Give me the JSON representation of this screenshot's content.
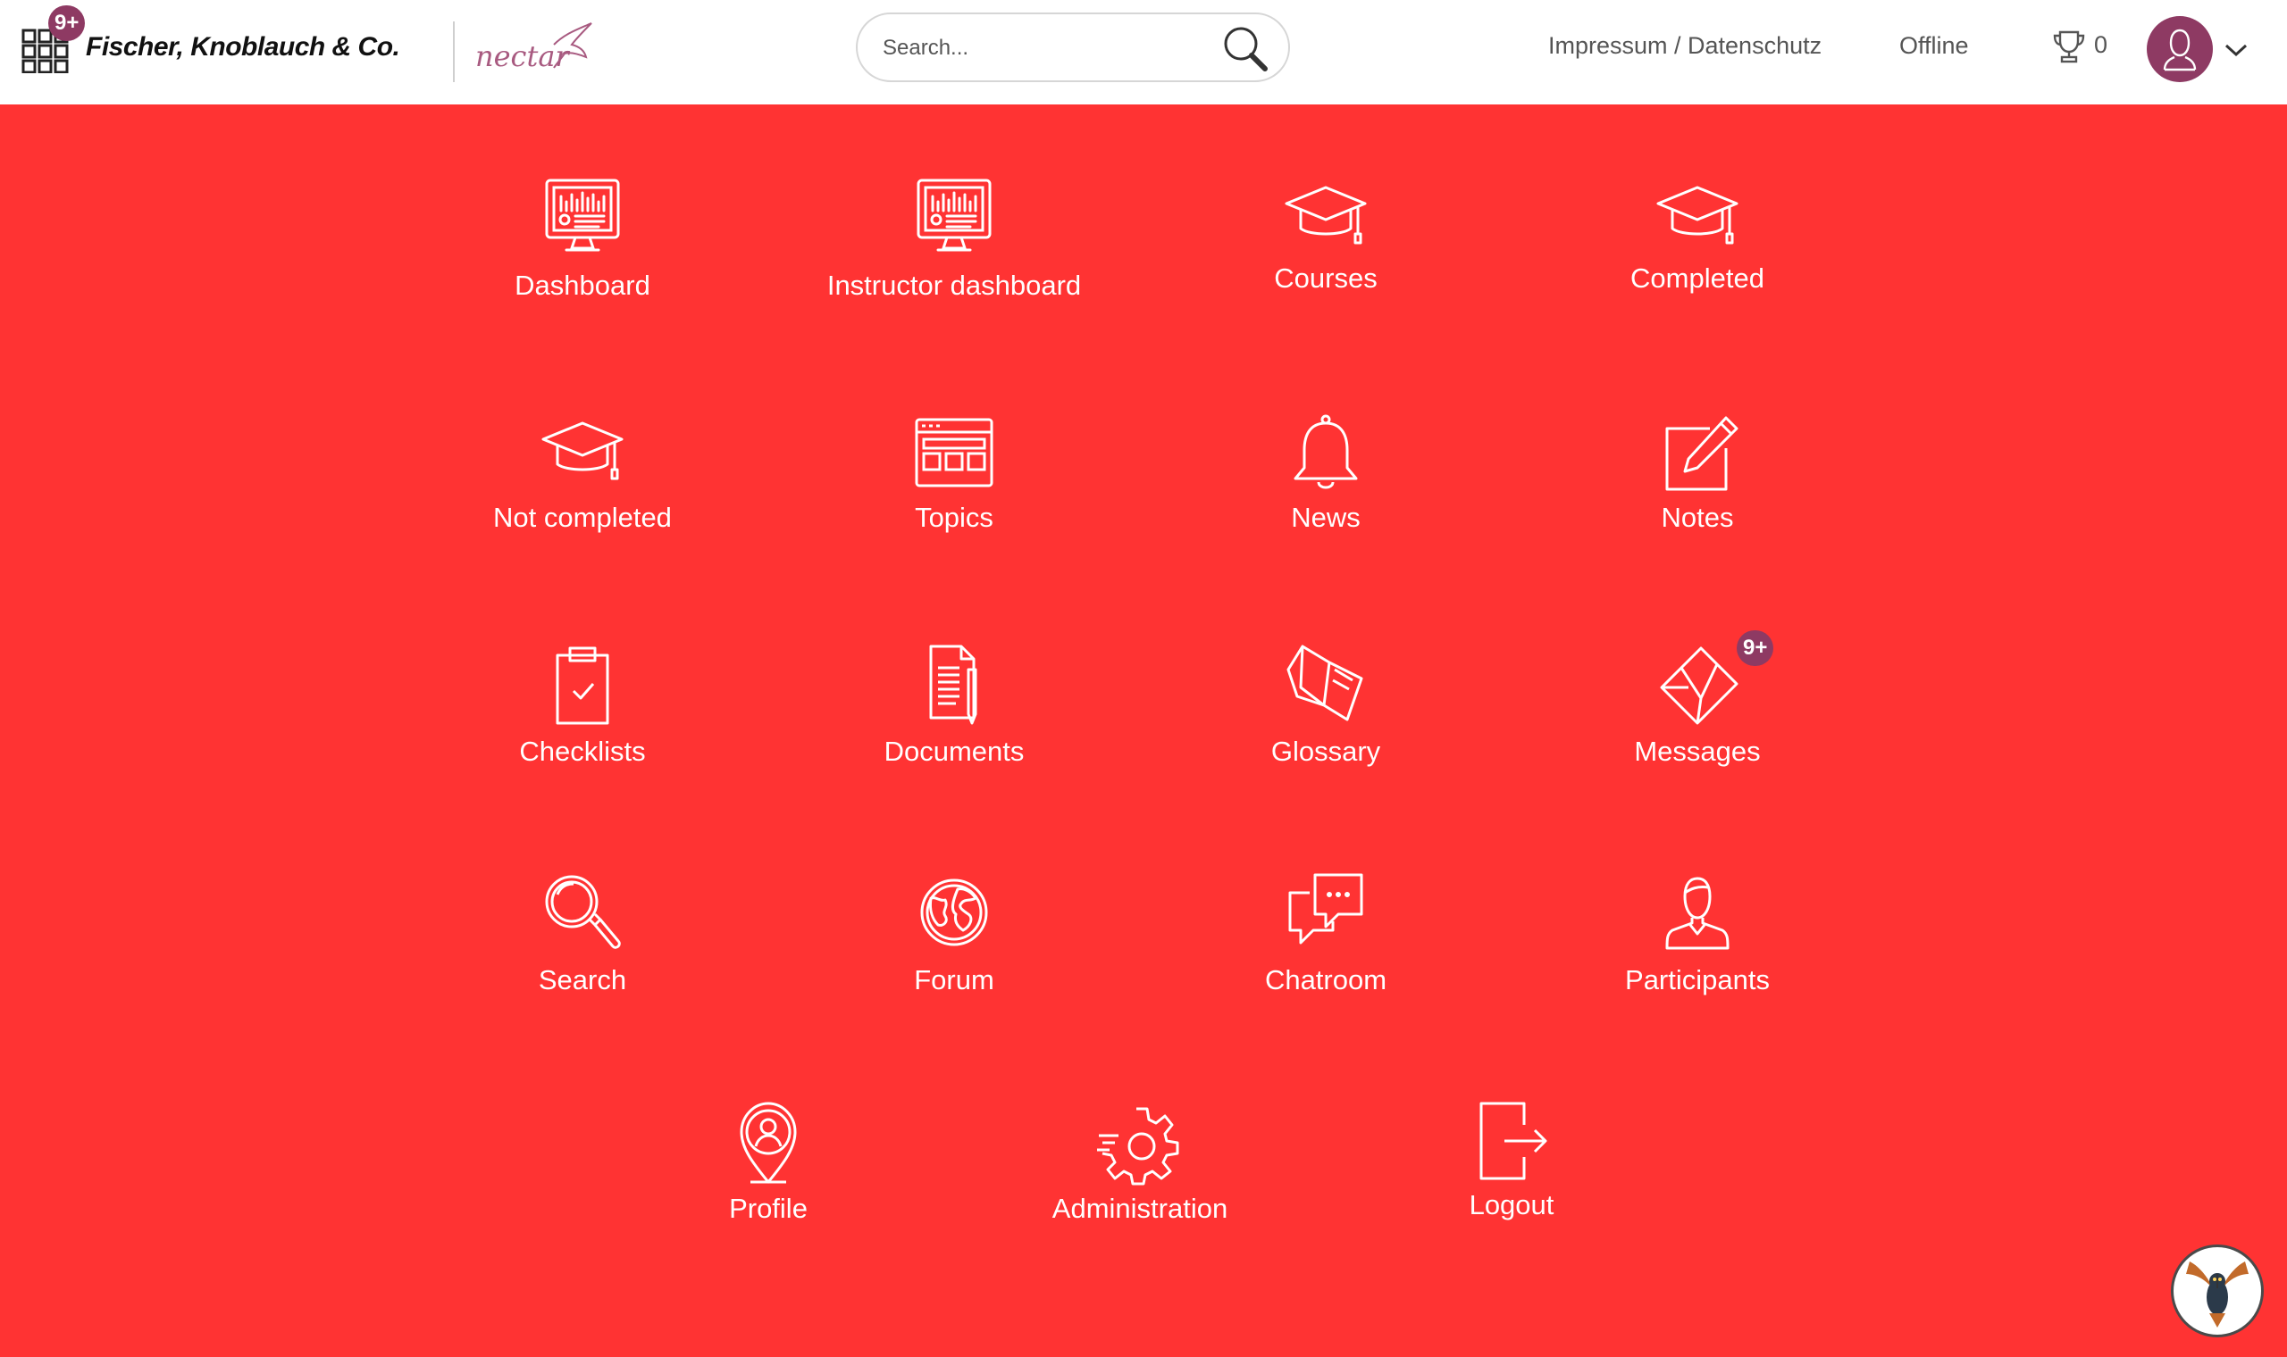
{
  "header": {
    "apps_badge": "9+",
    "company": "Fischer, Knoblauch & Co.",
    "brand_script": "nectar",
    "search_placeholder": "Search...",
    "imprint_label": "Impressum / Datenschutz",
    "status_label": "Offline",
    "trophy_count": "0"
  },
  "tiles": [
    {
      "label": "Dashboard",
      "icon": "monitor-chart-icon"
    },
    {
      "label": "Instructor dashboard",
      "icon": "monitor-chart-icon"
    },
    {
      "label": "Courses",
      "icon": "graduation-cap-icon"
    },
    {
      "label": "Completed",
      "icon": "graduation-cap-icon"
    },
    {
      "label": "Not completed",
      "icon": "graduation-cap-icon"
    },
    {
      "label": "Topics",
      "icon": "browser-grid-icon"
    },
    {
      "label": "News",
      "icon": "bell-icon"
    },
    {
      "label": "Notes",
      "icon": "pencil-square-icon"
    },
    {
      "label": "Checklists",
      "icon": "clipboard-check-icon"
    },
    {
      "label": "Documents",
      "icon": "document-pen-icon"
    },
    {
      "label": "Glossary",
      "icon": "open-book-icon"
    },
    {
      "label": "Messages",
      "icon": "envelope-icon",
      "badge": "9+"
    },
    {
      "label": "Search",
      "icon": "magnifier-icon"
    },
    {
      "label": "Forum",
      "icon": "globe-icon"
    },
    {
      "label": "Chatroom",
      "icon": "chat-bubbles-icon"
    },
    {
      "label": "Participants",
      "icon": "person-icon"
    },
    {
      "label": "Profile",
      "icon": "location-person-icon"
    },
    {
      "label": "Administration",
      "icon": "gear-icon"
    },
    {
      "label": "Logout",
      "icon": "logout-icon"
    }
  ],
  "colors": {
    "background": "#ff3333",
    "header_bg": "#ffffff",
    "accent": "#8e3a63",
    "icon_stroke": "#ffffff"
  }
}
